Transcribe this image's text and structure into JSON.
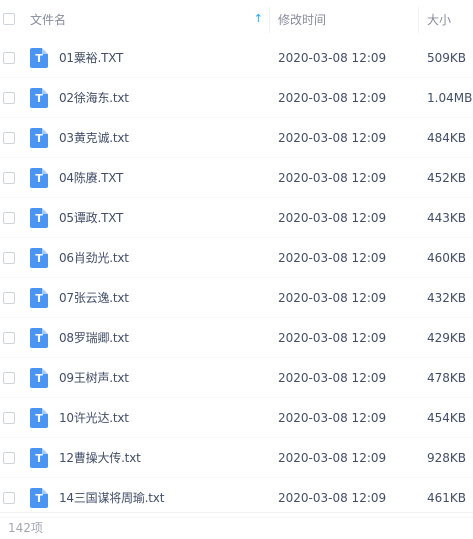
{
  "header": {
    "name_label": "文件名",
    "time_label": "修改时间",
    "size_label": "大小",
    "sort_icon": "sort-up-arrow-icon"
  },
  "files": [
    {
      "name": "01粟裕.TXT",
      "time": "2020-03-08 12:09",
      "size": "509KB"
    },
    {
      "name": "02徐海东.txt",
      "time": "2020-03-08 12:09",
      "size": "1.04MB"
    },
    {
      "name": "03黄克诚.txt",
      "time": "2020-03-08 12:09",
      "size": "484KB"
    },
    {
      "name": "04陈赓.TXT",
      "time": "2020-03-08 12:09",
      "size": "452KB"
    },
    {
      "name": "05谭政.TXT",
      "time": "2020-03-08 12:09",
      "size": "443KB"
    },
    {
      "name": "06肖劲光.txt",
      "time": "2020-03-08 12:09",
      "size": "460KB"
    },
    {
      "name": "07张云逸.txt",
      "time": "2020-03-08 12:09",
      "size": "432KB"
    },
    {
      "name": "08罗瑞卿.txt",
      "time": "2020-03-08 12:09",
      "size": "429KB"
    },
    {
      "name": "09王树声.txt",
      "time": "2020-03-08 12:09",
      "size": "478KB"
    },
    {
      "name": "10许光达.txt",
      "time": "2020-03-08 12:09",
      "size": "454KB"
    },
    {
      "name": "12曹操大传.txt",
      "time": "2020-03-08 12:09",
      "size": "928KB"
    },
    {
      "name": "14三国谋将周瑜.txt",
      "time": "2020-03-08 12:09",
      "size": "461KB"
    }
  ],
  "file_icon": {
    "glyph": "T",
    "color": "#4b94f3"
  },
  "footer": {
    "count_text": "142项"
  },
  "colors": {
    "accent": "#09aaff",
    "text": "#424e67",
    "muted": "#878c9c"
  }
}
